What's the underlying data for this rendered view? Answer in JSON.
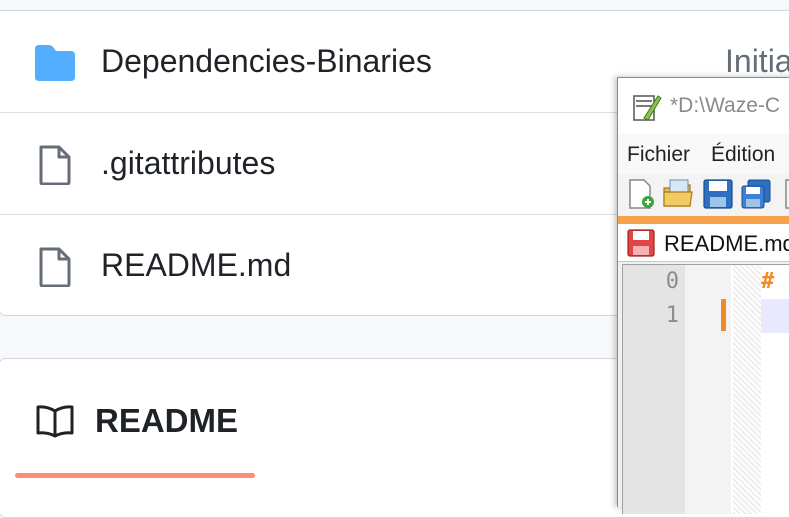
{
  "files": [
    {
      "name": "Dependencies-Binaries",
      "icon": "folder-icon",
      "commit": "Initia"
    },
    {
      "name": ".gitattributes",
      "icon": "file-icon",
      "commit": ""
    },
    {
      "name": "README.md",
      "icon": "file-icon",
      "commit": ""
    }
  ],
  "readme": {
    "tab_label": "README",
    "accent": "#fd8c73"
  },
  "notepad": {
    "title": "*D:\\Waze-C",
    "menus": [
      "Fichier",
      "Édition"
    ],
    "tab_name": "README.md",
    "line_numbers": [
      "0",
      "1"
    ],
    "code_lines": [
      "#",
      "!"
    ],
    "accent": "#f7a24a"
  },
  "colors": {
    "folder": "#54aeff",
    "file_icon": "#656d76"
  }
}
